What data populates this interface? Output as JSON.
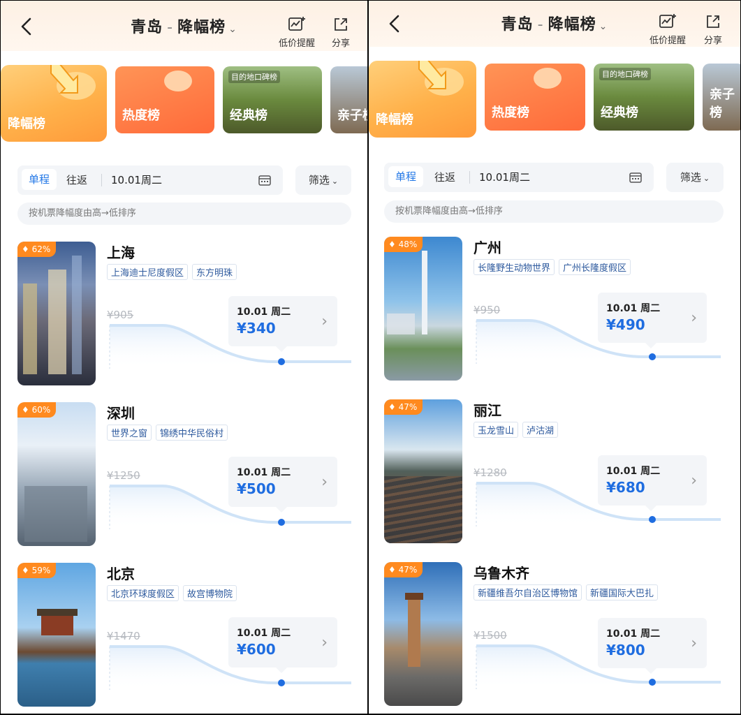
{
  "header": {
    "origin": "青岛",
    "separator": "-",
    "rank_title": "降幅榜",
    "chevron": "⌄",
    "alert_label": "低价提醒",
    "share_label": "分享"
  },
  "categories": [
    {
      "label": "降幅榜",
      "active": true
    },
    {
      "label": "热度榜",
      "active": false
    },
    {
      "label": "经典榜",
      "active": false,
      "badge": "目的地口碑榜"
    },
    {
      "label": "亲子榜",
      "active": false
    }
  ],
  "filters": {
    "oneway": "单程",
    "roundtrip": "往返",
    "date": "10.01周二",
    "filter_label": "筛选",
    "filter_chevron": "⌄",
    "sort_hint": "按机票降幅度由高→低排序"
  },
  "left_list": [
    {
      "city": "上海",
      "percent": "62%",
      "tags": [
        "上海迪士尼度假区",
        "东方明珠"
      ],
      "original_price": "¥905",
      "date": "10.01 周二",
      "price": "¥340"
    },
    {
      "city": "深圳",
      "percent": "60%",
      "tags": [
        "世界之窗",
        "锦绣中华民俗村"
      ],
      "original_price": "¥1250",
      "date": "10.01 周二",
      "price": "¥500"
    },
    {
      "city": "北京",
      "percent": "59%",
      "tags": [
        "北京环球度假区",
        "故宫博物院"
      ],
      "original_price": "¥1470",
      "date": "10.01 周二",
      "price": "¥600"
    }
  ],
  "right_list": [
    {
      "city": "广州",
      "percent": "48%",
      "tags": [
        "长隆野生动物世界",
        "广州长隆度假区"
      ],
      "original_price": "¥950",
      "date": "10.01 周二",
      "price": "¥490"
    },
    {
      "city": "丽江",
      "percent": "47%",
      "tags": [
        "玉龙雪山",
        "泸沽湖"
      ],
      "original_price": "¥1280",
      "date": "10.01 周二",
      "price": "¥680"
    },
    {
      "city": "乌鲁木齐",
      "percent": "47%",
      "tags": [
        "新疆维吾尔自治区博物馆",
        "新疆国际大巴扎"
      ],
      "original_price": "¥1500",
      "date": "10.01 周二",
      "price": "¥800"
    }
  ],
  "colors": {
    "accent_blue": "#1f6de0",
    "tab_blue": "#2277e6",
    "badge_orange": "#ff8a1f",
    "trend_line": "#cfe3f7",
    "trend_dot": "#1f6de0"
  },
  "icons": {
    "back": "chevron-left-icon",
    "alert": "price-alert-chart-icon",
    "share": "share-icon",
    "calendar": "calendar-icon",
    "diamond": "diamond-icon",
    "arrow": "chevron-right-icon"
  }
}
